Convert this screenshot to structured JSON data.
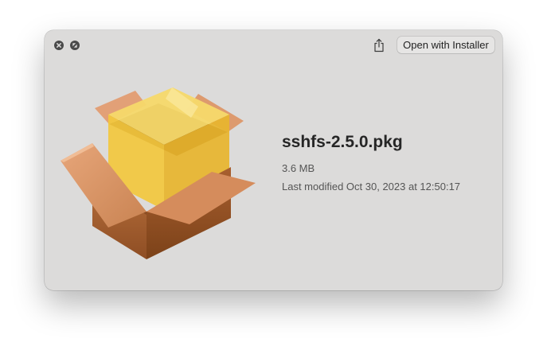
{
  "window": {
    "controls": {
      "close_icon": "close-icon",
      "fullscreen_icon": "fullscreen-icon"
    },
    "toolbar": {
      "share_icon": "share-icon",
      "open_button_label": "Open with Installer"
    }
  },
  "file": {
    "icon": "package-icon",
    "name": "sshfs-2.5.0.pkg",
    "size": "3.6 MB",
    "modified": "Last modified Oct 30, 2023 at 12:50:17"
  }
}
